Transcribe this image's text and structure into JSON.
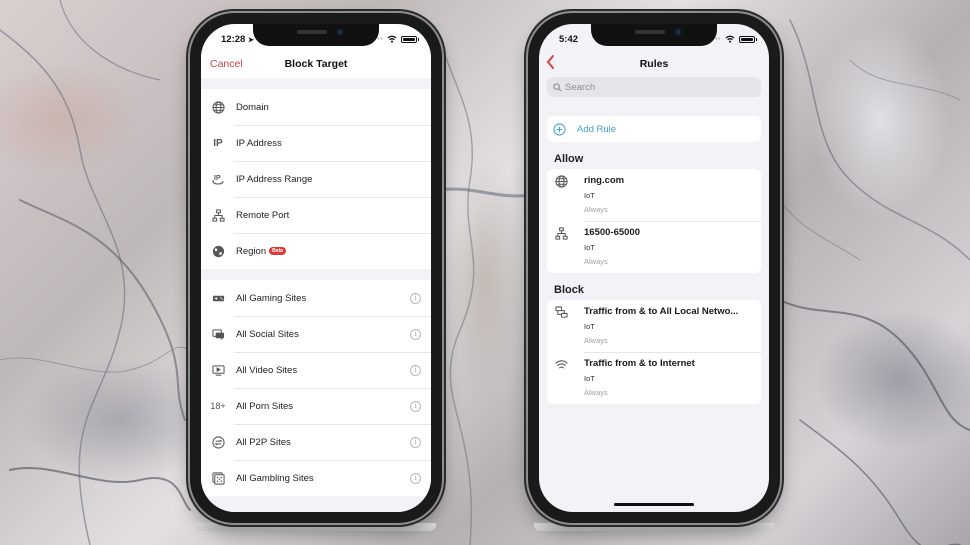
{
  "left_phone": {
    "status": {
      "time": "12:28",
      "location_arrow": true
    },
    "nav": {
      "cancel_label": "Cancel",
      "title": "Block Target"
    },
    "target_types": [
      {
        "icon": "globe-icon",
        "label": "Domain"
      },
      {
        "icon": "ip-icon",
        "label": "IP Address",
        "icon_text": "IP"
      },
      {
        "icon": "ip-range-icon",
        "label": "IP Address Range"
      },
      {
        "icon": "network-icon",
        "label": "Remote Port"
      },
      {
        "icon": "earth-icon",
        "label": "Region",
        "badge": "Beta"
      }
    ],
    "site_categories": [
      {
        "icon": "gamepad-icon",
        "label": "All Gaming Sites"
      },
      {
        "icon": "chat-bubbles-icon",
        "label": "All Social Sites"
      },
      {
        "icon": "video-icon",
        "label": "All Video Sites"
      },
      {
        "icon": "adult-18-icon",
        "label": "All Porn Sites",
        "icon_text": "18+"
      },
      {
        "icon": "p2p-icon",
        "label": "All P2P Sites"
      },
      {
        "icon": "dice-icon",
        "label": "All Gambling Sites"
      }
    ],
    "info_glyph": "i"
  },
  "right_phone": {
    "status": {
      "time": "5:42"
    },
    "nav": {
      "title": "Rules"
    },
    "search": {
      "placeholder": "Search",
      "value": ""
    },
    "add_rule_label": "Add Rule",
    "sections": [
      {
        "title": "Allow",
        "rules": [
          {
            "icon": "globe-icon",
            "title": "ring.com",
            "device": "IoT",
            "schedule": "Always"
          },
          {
            "icon": "network-icon",
            "title": "16500-65000",
            "device": "IoT",
            "schedule": "Always"
          }
        ]
      },
      {
        "title": "Block",
        "rules": [
          {
            "icon": "local-network-icon",
            "title": "Traffic from & to All Local Netwo...",
            "device": "IoT",
            "schedule": "Always"
          },
          {
            "icon": "wifi-icon",
            "title": "Traffic from & to Internet",
            "device": "IoT",
            "schedule": "Always"
          }
        ]
      }
    ]
  },
  "colors": {
    "cancel": "#d0444a",
    "back_chevron": "#d0444a",
    "add_rule": "#3ea3d8",
    "beta_badge": "#d93a3a",
    "grouped_bg": "#f2f2f7"
  }
}
